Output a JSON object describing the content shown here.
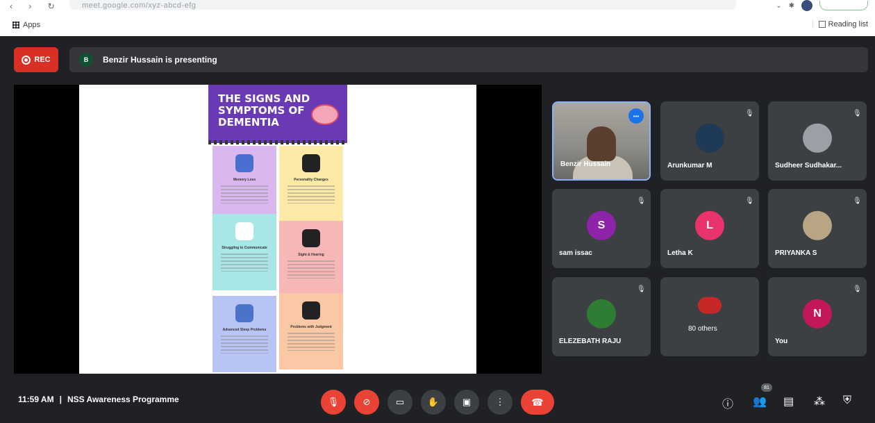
{
  "browser": {
    "nav_glyphs": "‹ › ↻",
    "url": "meet.google.com/xyz-abcd-efg",
    "bookmarks": {
      "apps_label": "Apps",
      "reading_list_label": "Reading list"
    }
  },
  "meet": {
    "rec_label": "REC",
    "presenter_initial": "B",
    "presenting_text": "Benzir Hussain is presenting",
    "meeting_time": "11:59 AM",
    "separator": "|",
    "meeting_name": "NSS Awareness Programme",
    "participants_badge": "81"
  },
  "slide": {
    "title": "THE SIGNS AND SYMPTOMS OF DEMENTIA",
    "cards": [
      {
        "title": "Memory Loss",
        "color": "#d9b7ef",
        "icon_color": "#4a6fd1"
      },
      {
        "title": "Personality Changes",
        "color": "#fbe9a6",
        "icon_color": "#222222"
      },
      {
        "title": "Struggling to Communicate",
        "color": "#a9e6e6",
        "icon_color": "#ffffff"
      },
      {
        "title": "Sight & Hearing",
        "color": "#f8b7b7",
        "icon_color": "#222222"
      },
      {
        "title": "Advanced Sleep Problems",
        "color": "#b7c4f4",
        "icon_color": "#4a73c9"
      },
      {
        "title": "Problems with Judgment",
        "color": "#fbc8a6",
        "icon_color": "#222222"
      }
    ]
  },
  "tiles": [
    {
      "name": "Benzir Hussain",
      "type": "video"
    },
    {
      "name": "Arunkumar M",
      "type": "photo",
      "color": "#1f3a57"
    },
    {
      "name": "Sudheer Sudhakar...",
      "type": "photo",
      "color": "#9aa0a6"
    },
    {
      "name": "sam issac",
      "type": "initial",
      "initial": "S",
      "color": "#8e24aa"
    },
    {
      "name": "Letha K",
      "type": "initial",
      "initial": "L",
      "color": "#e8336b"
    },
    {
      "name": "PRIYANKA S",
      "type": "photo",
      "color": "#b7a583"
    },
    {
      "name": "ELEZEBATH RAJU",
      "type": "photo",
      "color": "#2e7d32"
    },
    {
      "name": "80 others",
      "type": "others",
      "color": "#c62828"
    },
    {
      "name": "You",
      "type": "initial",
      "initial": "N",
      "color": "#c2185b"
    }
  ]
}
